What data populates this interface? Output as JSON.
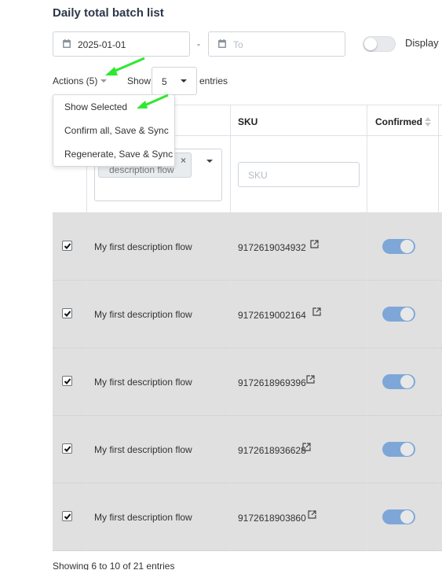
{
  "page": {
    "title": "Daily total batch list"
  },
  "filters": {
    "date_from": "2025-01-01",
    "date_separator": "-",
    "date_to_placeholder": "To",
    "display_label": "Display",
    "display_toggle_on": false
  },
  "toolbar": {
    "actions_label": "Actions (5)",
    "show_label": "Show",
    "entries_value": "5",
    "entries_label": "entries"
  },
  "actions_menu": {
    "items": [
      "Show Selected",
      "Confirm all, Save & Sync",
      "Regenerate, Save & Sync"
    ]
  },
  "table": {
    "columns": {
      "sku": "SKU",
      "confirmed": "Confirmed"
    },
    "filter": {
      "flow_chip": "description flow",
      "flow_chip_remove": "×",
      "sku_placeholder": "SKU"
    },
    "rows": [
      {
        "checked": true,
        "flow": "My first description flow",
        "sku": "9172619034932",
        "confirmed": true
      },
      {
        "checked": true,
        "flow": "My first description flow",
        "sku": "9172619002164",
        "confirmed": true
      },
      {
        "checked": true,
        "flow": "My first description flow",
        "sku": "9172618969396",
        "confirmed": true
      },
      {
        "checked": true,
        "flow": "My first description flow",
        "sku": "9172618936628",
        "confirmed": true
      },
      {
        "checked": true,
        "flow": "My first description flow",
        "sku": "9172618903860",
        "confirmed": true
      }
    ]
  },
  "footer": {
    "info": "Showing 6 to 10 of 21 entries"
  },
  "colors": {
    "annotation_arrow": "#2ee82e",
    "toggle_on": "#7ea7d8",
    "row_bg": "#e0e0e0"
  },
  "icons": [
    "calendar-icon",
    "external-link-icon",
    "sort-icon",
    "checkbox-checked-icon"
  ]
}
